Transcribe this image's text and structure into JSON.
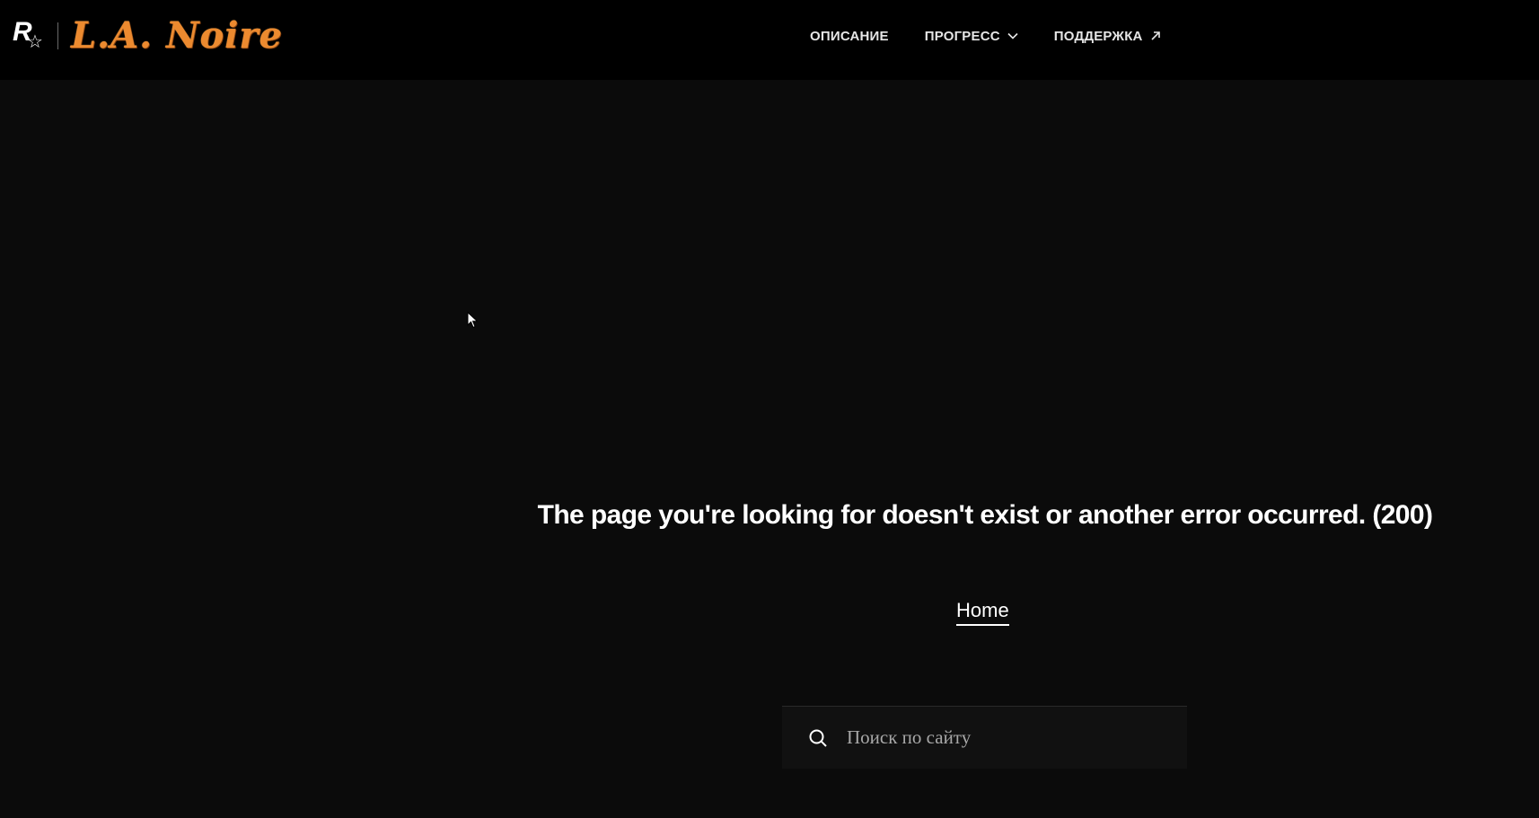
{
  "header": {
    "publisher_logo": "R★",
    "game_logo": "L.A. Noire",
    "nav": [
      {
        "label": "ОПИСАНИЕ",
        "icon": null
      },
      {
        "label": "ПРОГРЕСС",
        "icon": "chevron-down-icon"
      },
      {
        "label": "ПОДДЕРЖКА",
        "icon": "external-link-arrow-icon"
      }
    ]
  },
  "main": {
    "error_message": "The page you're looking for doesn't exist or another error occurred. (200)",
    "home_link": "Home",
    "search": {
      "placeholder": "Поиск по сайту",
      "value": "",
      "icon": "search-icon"
    }
  },
  "colors": {
    "background": "#0b0b0b",
    "header_background": "#000000",
    "logo_orange": "#ec8a2f",
    "text": "#ffffff",
    "nav_text": "#e6e6e6",
    "placeholder": "#a8a8a8",
    "search_background": "#111111"
  }
}
